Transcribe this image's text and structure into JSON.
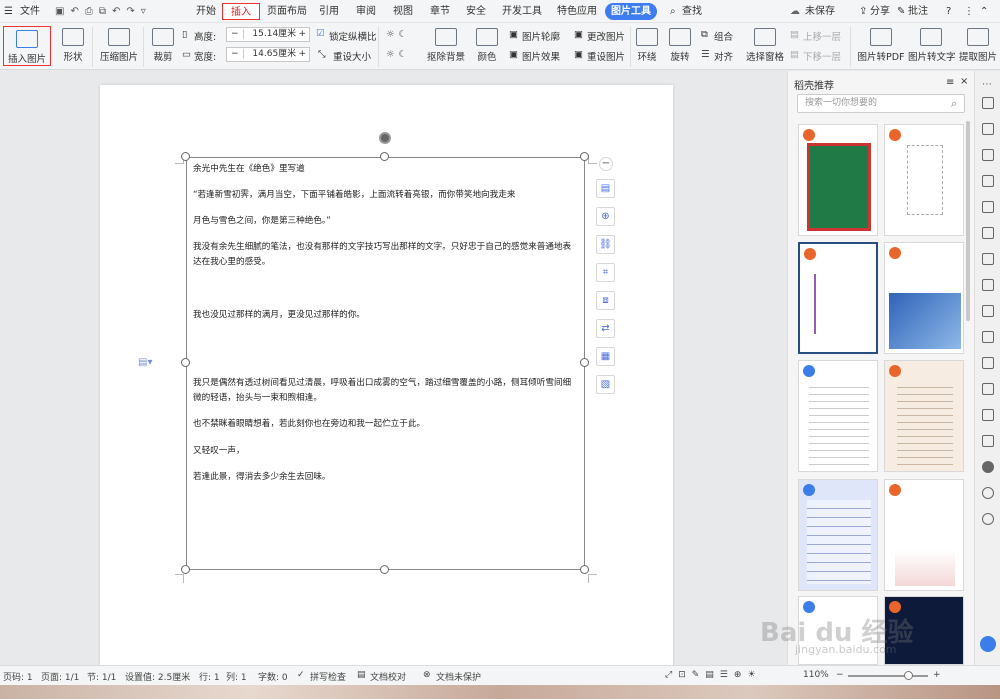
{
  "menu": {
    "file": "文件",
    "tabs": [
      "开始",
      "插入",
      "页面布局",
      "引用",
      "审阅",
      "视图",
      "章节",
      "安全",
      "开发工具",
      "特色应用"
    ],
    "picture_tools": "图片工具",
    "search": "查找",
    "unsaved": "未保存",
    "share": "分享",
    "annotate": "批注"
  },
  "ribbon": {
    "insert_picture": "插入图片",
    "shape": "形状",
    "compress": "压缩图片",
    "crop": "裁剪",
    "height_label": "高度:",
    "height_value": "15.14厘米",
    "width_label": "宽度:",
    "width_value": "14.65厘米",
    "lock_ratio": "锁定纵横比",
    "reset_size": "重设大小",
    "remove_bg": "抠除背景",
    "color": "颜色",
    "outline": "图片轮廓",
    "effect": "图片效果",
    "change_pic": "更改图片",
    "reset_pic": "重设图片",
    "wrap": "环绕",
    "rotate": "旋转",
    "group": "组合",
    "align": "对齐",
    "selection_pane": "选择窗格",
    "bring_forward": "上移一层",
    "send_backward": "下移一层",
    "to_pdf": "图片转PDF",
    "to_text": "图片转文字",
    "extract": "提取图片"
  },
  "doc": {
    "paragraphs": [
      "余光中先生在《绝色》里写道",
      "“若逢新雪初霁，满月当空，下面平铺着皓影，上面流转着亮银，而你带笑地向我走来",
      "月色与雪色之间，你是第三种绝色。”",
      "我没有余先生细腻的笔法，也没有那样的文字技巧写出那样的文字。只好忠于自己的感觉来普通地表达在我心里的感受。",
      "我也没见过那样的满月，更没见过那样的你。",
      "我只是偶然有透过树间看见过清晨，呼吸着出口成雾的空气，踏过细雪覆盖的小路，侧耳倾听雪间细微的轻语，抬头与一束和煦相逢。",
      "也不禁眯着眼睛想着，若此刻你也在旁边和我一起伫立于此。",
      "又轻叹一声，",
      "若逢此景，得消去多少余生去回味。"
    ]
  },
  "panel": {
    "title": "稻壳推荐",
    "search_placeholder": "搜索一切你想要的"
  },
  "status": {
    "page_num": "页码: 1",
    "pages": "页面: 1/1",
    "section": "节: 1/1",
    "setting": "设置值: 2.5厘米",
    "row": "行: 1",
    "col": "列: 1",
    "words": "字数: 0",
    "spell": "拼写检查",
    "proof": "文档校对",
    "protect": "文档未保护",
    "zoom": "110%"
  },
  "watermark": {
    "logo": "Bai du 经验",
    "url": "jingyan.baidu.com"
  },
  "colors": {
    "accent": "#3d7cf2",
    "highlight_border": "#e33333"
  }
}
